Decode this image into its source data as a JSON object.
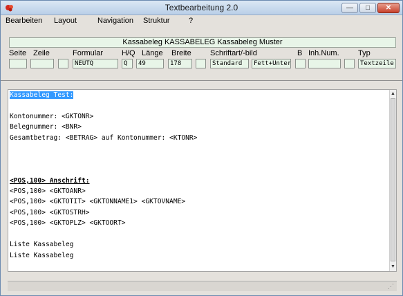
{
  "window": {
    "title": "Textbearbeitung 2.0",
    "accent_color": "#b9cfe8",
    "field_bg_color": "#e8f5e8",
    "selection_color": "#3399ff"
  },
  "titlebar_buttons": {
    "minimize": "—",
    "maximize": "□",
    "close": "✕"
  },
  "menu": {
    "items": [
      "Bearbeiten",
      "Layout",
      "Navigation",
      "Struktur",
      "?"
    ]
  },
  "header": {
    "text": "Kassabeleg KASSABELEG Kassabeleg Muster"
  },
  "fields": {
    "labels": {
      "seite": "Seite",
      "zeile": "Zeile",
      "formular": "Formular",
      "hq": "H/Q",
      "laenge": "Länge",
      "breite": "Breite",
      "schriftart": "Schriftart/-bild",
      "b": "B",
      "inhnum": "Inh.Num.",
      "typ": "Typ"
    },
    "values": {
      "seite": "",
      "zeile": "",
      "zeile_extra": "",
      "formular": "NEUTQ",
      "hq": "Q",
      "laenge": "49",
      "breite": "178",
      "breite_extra": "",
      "schriftart": "Standard",
      "schriftbild": "Fett+Unter",
      "b": "",
      "inhnum": "",
      "inhnum_extra": "",
      "typ": "Textzeile"
    }
  },
  "editor": {
    "lines": [
      "Kassabeleg Test:",
      "",
      "Kontonummer: <GKTONR>",
      "Belegnummer: <BNR>",
      "Gesamtbetrag: <BETRAG> auf Kontonummer: <KTONR>",
      "",
      "",
      "",
      "<POS,100> Anschrift:",
      "<POS,100> <GKTOANR>",
      "<POS,100> <GKTOTIT> <GKTONNAME1> <GKTOVNAME>",
      "<POS,100> <GKTOSTRH>",
      "<POS,100> <GKTOPLZ> <GKTOORT>",
      "",
      "Liste Kassabeleg",
      "Liste Kassabeleg"
    ],
    "selected_line": 0,
    "bold_line": 8
  },
  "scrollbar": {
    "up": "▲",
    "down": "▼"
  },
  "statusbar": {
    "grip": "⋰"
  }
}
